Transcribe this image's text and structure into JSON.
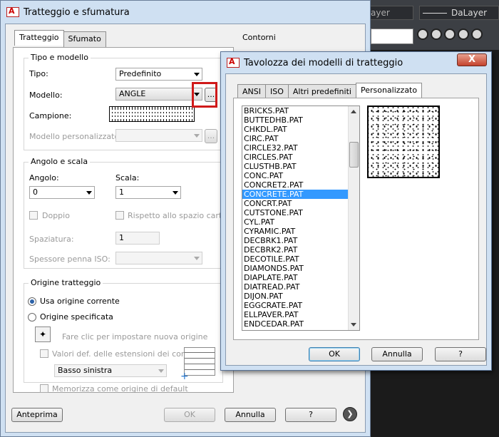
{
  "background": {
    "layer_value": "ayer",
    "linetype_value": "DaLayer"
  },
  "main_dialog": {
    "title": "Tratteggio e sfumatura",
    "tabs": [
      "Tratteggio",
      "Sfumato"
    ],
    "contorni_label": "Contorni",
    "tipo_modello": {
      "legend": "Tipo e modello",
      "tipo_label": "Tipo:",
      "tipo_value": "Predefinito",
      "modello_label": "Modello:",
      "modello_value": "ANGLE",
      "browse_label": "...",
      "campione_label": "Campione:",
      "personalizzato_label": "Modello personalizzato:",
      "personalizzato_value": ""
    },
    "angolo_scala": {
      "legend": "Angolo e scala",
      "angolo_label": "Angolo:",
      "angolo_value": "0",
      "scala_label": "Scala:",
      "scala_value": "1",
      "doppio_label": "Doppio",
      "rispetto_label": "Rispetto allo spazio carta",
      "spaziatura_label": "Spaziatura:",
      "spaziatura_value": "1",
      "spessore_label": "Spessore penna ISO:",
      "spessore_value": ""
    },
    "origine": {
      "legend": "Origine tratteggio",
      "corrente_label": "Usa origine corrente",
      "specificata_label": "Origine specificata",
      "fare_clic_label": "Fare clic per impostare nuova origine",
      "valori_label": "Valori def. delle estensioni dei contorni",
      "basso_value": "Basso sinistra",
      "memorizza_label": "Memorizza come origine di default"
    },
    "buttons": {
      "anteprima": "Anteprima",
      "ok": "OK",
      "annulla": "Annulla",
      "help": "?"
    }
  },
  "palette": {
    "title": "Tavolozza dei modelli di tratteggio",
    "close_label": "X",
    "tabs": [
      "ANSI",
      "ISO",
      "Altri predefiniti",
      "Personalizzato"
    ],
    "patterns": [
      "BRICKS.PAT",
      "BUTTEDHB.PAT",
      "CHKDL.PAT",
      "CIRC.PAT",
      "CIRCLE32.PAT",
      "CIRCLES.PAT",
      "CLUSTHB.PAT",
      "CONC.PAT",
      "CONCRET2.PAT",
      "CONCRETE.PAT",
      "CONCRT.PAT",
      "CUTSTONE.PAT",
      "CYL.PAT",
      "CYRAMIC.PAT",
      "DECBRK1.PAT",
      "DECBRK2.PAT",
      "DECOTILE.PAT",
      "DIAMONDS.PAT",
      "DIAPLATE.PAT",
      "DIATREAD.PAT",
      "DIJON.PAT",
      "EGGCRATE.PAT",
      "ELLPAVER.PAT",
      "ENDCEDAR.PAT"
    ],
    "selected_pattern": "CONCRETE.PAT",
    "buttons": {
      "ok": "OK",
      "annulla": "Annulla",
      "help": "?"
    }
  }
}
